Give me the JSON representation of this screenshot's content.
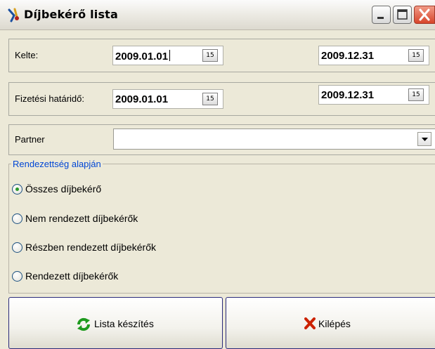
{
  "window": {
    "title": "Díjbekérő lista",
    "icon": "app-icon",
    "controls": [
      "minimize-icon",
      "maximize-icon",
      "close-icon"
    ]
  },
  "kelte": {
    "label": "Kelte:",
    "from": "2009.01.01",
    "to": "2009.12.31"
  },
  "fizetesi": {
    "label": "Fizetési határidő:",
    "from": "2009.01.01",
    "to": "2009.12.31"
  },
  "calendar_button_text": "15",
  "partner": {
    "label": "Partner",
    "value": ""
  },
  "group": {
    "title": "Rendezettség alapján",
    "options": [
      {
        "label": "Összes díjbekérő",
        "selected": true
      },
      {
        "label": "Nem rendezett díjbekérők",
        "selected": false
      },
      {
        "label": "Részben rendezett díjbekérők",
        "selected": false
      },
      {
        "label": "Rendezett díjbekérők",
        "selected": false
      }
    ]
  },
  "buttons": {
    "list_label": "Lista készítés",
    "list_icon": "refresh-icon",
    "exit_label": "Kilépés",
    "exit_icon": "x-icon"
  },
  "colors": {
    "group_title": "#0046d5",
    "selected_radio": "#2a9a2a",
    "refresh_icon": "#1e9a1e",
    "exit_icon": "#cc2200"
  }
}
